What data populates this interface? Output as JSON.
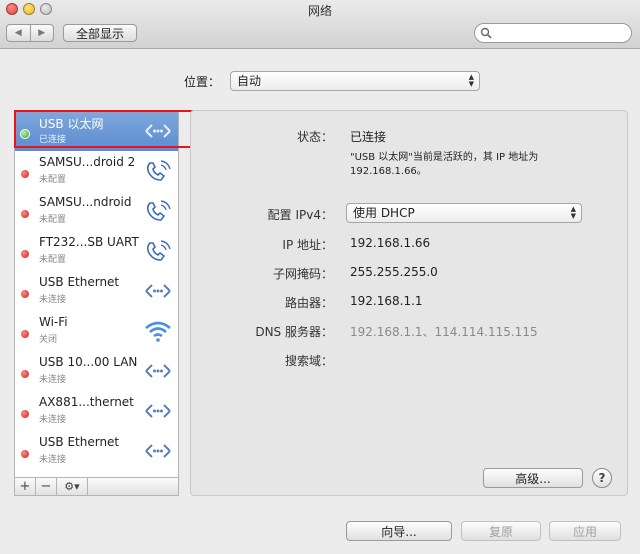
{
  "window": {
    "title": "网络"
  },
  "toolbar": {
    "back_icon": "◀",
    "forward_icon": "▶",
    "show_all_label": "全部显示",
    "search_placeholder": ""
  },
  "location": {
    "label": "位置：",
    "value": "自动"
  },
  "services": [
    {
      "name": "USB 以太网",
      "status": "已连接",
      "state": "connected",
      "icon": "ethernet-icon"
    },
    {
      "name": "SAMSU...droid 2",
      "status": "未配置",
      "state": "not-configured",
      "icon": "phone-icon"
    },
    {
      "name": "SAMSU...ndroid",
      "status": "未配置",
      "state": "not-configured",
      "icon": "phone-icon"
    },
    {
      "name": "FT232...SB UART",
      "status": "未配置",
      "state": "not-configured",
      "icon": "phone-icon"
    },
    {
      "name": "USB Ethernet",
      "status": "未连接",
      "state": "not-connected",
      "icon": "ethernet-icon"
    },
    {
      "name": "Wi-Fi",
      "status": "关闭",
      "state": "off",
      "icon": "wifi-icon"
    },
    {
      "name": "USB 10...00 LAN",
      "status": "未连接",
      "state": "not-connected",
      "icon": "ethernet-icon"
    },
    {
      "name": "AX881...thernet",
      "status": "未连接",
      "state": "not-connected",
      "icon": "ethernet-icon"
    },
    {
      "name": "USB Ethernet",
      "status": "未连接",
      "state": "not-connected",
      "icon": "ethernet-icon"
    }
  ],
  "sidebar_tools": {
    "add": "+",
    "remove": "−",
    "action": "⚙▾"
  },
  "detail": {
    "status_label": "状态：",
    "status_value": "已连接",
    "status_note": "\"USB 以太网\"当前是活跃的，其 IP 地址为 192.168.1.66。",
    "ipv4_label": "配置 IPv4：",
    "ipv4_value": "使用 DHCP",
    "ip_label": "IP 地址：",
    "ip_value": "192.168.1.66",
    "subnet_label": "子网掩码：",
    "subnet_value": "255.255.255.0",
    "router_label": "路由器：",
    "router_value": "192.168.1.1",
    "dns_label": "DNS 服务器：",
    "dns_value": "192.168.1.1、114.114.115.115",
    "search_domain_label": "搜索域：",
    "advanced_label": "高级...",
    "help_label": "?"
  },
  "bottom": {
    "assist_label": "向导...",
    "revert_label": "复原",
    "apply_label": "应用"
  },
  "colors": {
    "selection": "#5c8bd0",
    "highlight_box": "#e8141a",
    "status_red": "#cc1f1f",
    "status_green": "#34a529"
  }
}
